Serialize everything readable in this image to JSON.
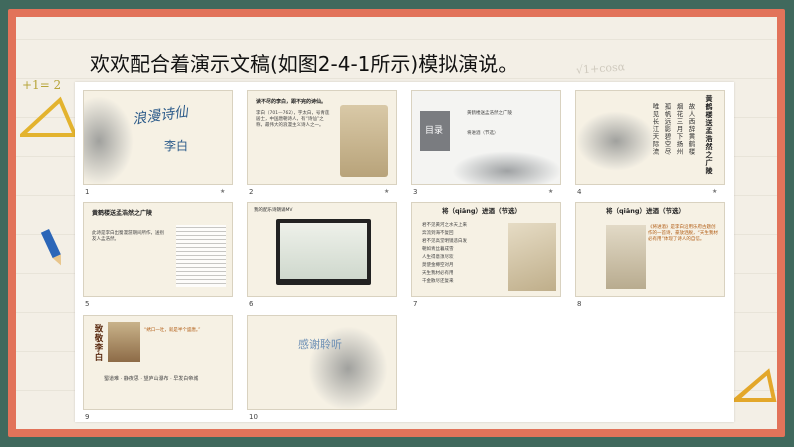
{
  "heading": "欢欢配合着演示文稿(如图2-4-1所示)模拟演说。",
  "deco": {
    "math_left": "+1= 2",
    "math_right": "√1+cosα"
  },
  "slides": [
    {
      "num": "1",
      "title": "浪漫诗仙",
      "subtitle": "李白"
    },
    {
      "num": "2",
      "title": "读不尽的李白，跟不完的诗仙。",
      "body": "李白（701—762），字太白，号青莲居士，中国唐朝诗人，有“诗仙”之称，最伟大的浪漫主义诗人之一。"
    },
    {
      "num": "3",
      "menu_title": "目录",
      "items": [
        "黄鹤楼送孟浩然之广陵",
        "将进酒（节选）"
      ]
    },
    {
      "num": "4",
      "title": "黄鹤楼送孟浩然之广陵",
      "poem": [
        "故人西辞黄鹤楼",
        "烟花三月下扬州",
        "孤帆远影碧空尽",
        "唯见长江天际流"
      ]
    },
    {
      "num": "5",
      "title": "黄鹤楼送孟浩然之广陵",
      "body": "此诗是李白出蜀漫游期间所作，送别友人孟浩然。"
    },
    {
      "num": "6",
      "title": "我的配乐诗朗诵MV"
    },
    {
      "num": "7",
      "title": "将（qiāng）进酒（节选）",
      "poem_lines": [
        "君不见黄河之水天上来",
        "奔流到海不复回",
        "君不见高堂明镜悲白发",
        "朝如青丝暮成雪",
        "人生得意须尽欢",
        "莫使金樽空对月",
        "天生我材必有用",
        "千金散尽还复来"
      ]
    },
    {
      "num": "8",
      "title": "将（qiāng）进酒（节选）",
      "body": "《将进酒》是李白沿用乐府古题创作的一首诗，豪放洒脱，“天生我材必有用”体现了诗人的自信。"
    },
    {
      "num": "9",
      "title": "致敬李白",
      "body": "“绣口一吐，就是半个盛唐。”"
    },
    {
      "num": "10",
      "title": "感谢聆听"
    }
  ],
  "star": "★"
}
